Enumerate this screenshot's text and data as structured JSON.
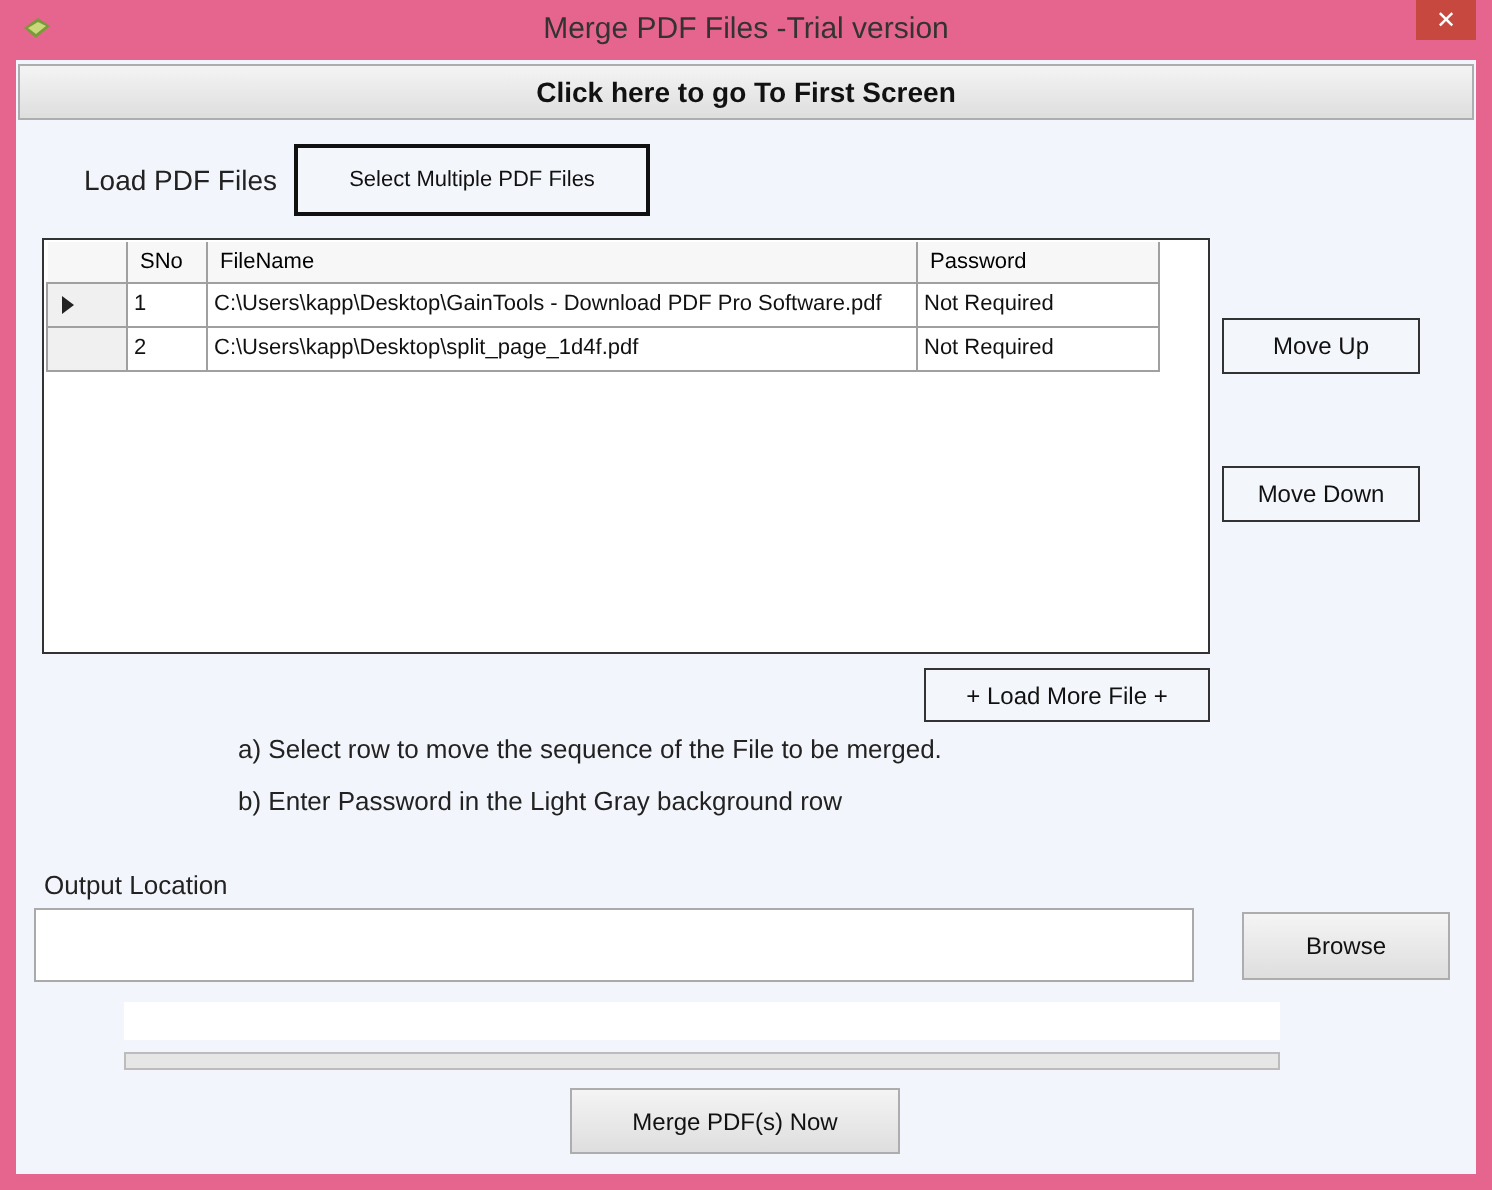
{
  "window": {
    "title": "Merge PDF Files -Trial version",
    "close": "✕"
  },
  "first_screen_button": "Click here to go To First Screen",
  "load_label": "Load PDF Files",
  "select_button": "Select Multiple PDF Files",
  "table": {
    "columns": [
      "SNo",
      "FileName",
      "Password"
    ],
    "rows": [
      {
        "selected": true,
        "cells": [
          "1",
          "C:\\Users\\kapp\\Desktop\\GainTools - Download PDF Pro Software.pdf",
          "Not Required"
        ]
      },
      {
        "selected": false,
        "cells": [
          "2",
          "C:\\Users\\kapp\\Desktop\\split_page_1d4f.pdf",
          "Not Required"
        ]
      }
    ]
  },
  "move_up_button": "Move Up",
  "move_down_button": "Move Down",
  "load_more_button": "+ Load More File +",
  "instructions": [
    "a) Select row to move the sequence of the File to be merged.",
    "b) Enter Password in the Light Gray background row"
  ],
  "output": {
    "label": "Output Location",
    "browse_button": "Browse"
  },
  "progress": {
    "level": 0
  },
  "merge_button": "Merge  PDF(s) Now"
}
